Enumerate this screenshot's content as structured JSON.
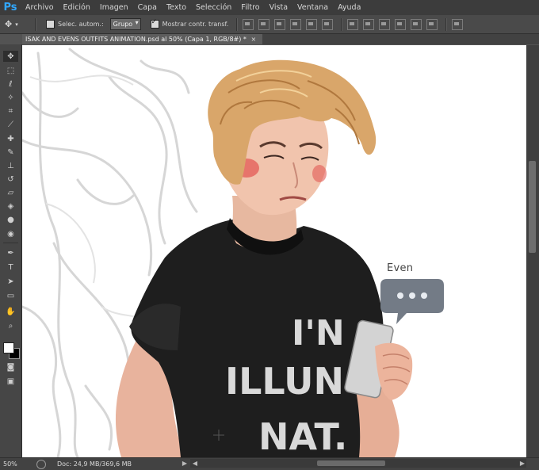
{
  "app": {
    "logo": "Ps",
    "menu": [
      "Archivo",
      "Edición",
      "Imagen",
      "Capa",
      "Texto",
      "Selección",
      "Filtro",
      "Vista",
      "Ventana",
      "Ayuda"
    ]
  },
  "options_bar": {
    "auto_select_label": "Selec. autom.:",
    "auto_select_checked": false,
    "auto_select_value": "Grupo",
    "transform_label": "Mostrar contr. transf.",
    "transform_checked": true
  },
  "document_tab": {
    "title": "ISAK AND EVENS OUTFITS ANIMATION.psd al 50% (Capa 1, RGB/8#) *",
    "close": "×"
  },
  "tools": [
    "move-tool",
    "marquee-tool",
    "lasso-tool",
    "magic-wand-tool",
    "crop-tool",
    "eyedropper-tool",
    "healing-tool",
    "brush-tool",
    "stamp-tool",
    "history-brush-tool",
    "eraser-tool",
    "paint-bucket-tool",
    "blur-tool",
    "dodge-tool",
    "pen-tool",
    "type-tool",
    "path-select-tool",
    "shape-tool",
    "hand-tool",
    "zoom-tool"
  ],
  "colors": {
    "foreground": "#ffffff",
    "background": "#000000"
  },
  "artwork": {
    "speech_label": "Even",
    "shirt_text": [
      "I'N",
      "ILLUN",
      "NAT."
    ]
  },
  "status": {
    "zoom": "50%",
    "doc_size": "Doc: 24,9 MB/369,6 MB"
  }
}
